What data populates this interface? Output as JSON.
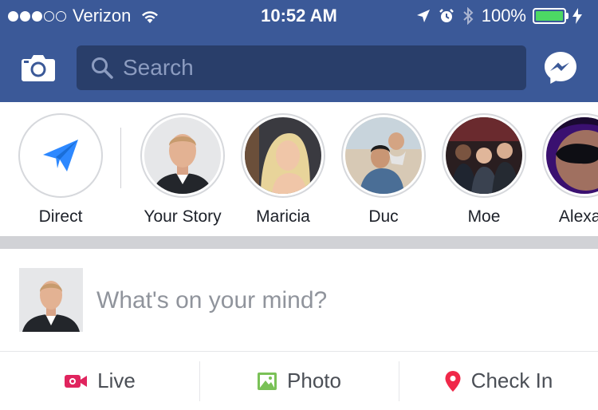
{
  "status_bar": {
    "carrier": "Verizon",
    "signal": {
      "full": 3,
      "empty": 2
    },
    "time": "10:52 AM",
    "battery_percent": "100%",
    "battery_level": 1.0,
    "battery_color": "#4cd964"
  },
  "header": {
    "bg_color": "#3b5998",
    "search_placeholder": "Search",
    "icons": [
      "camera-icon",
      "search-icon",
      "messenger-icon"
    ]
  },
  "stories": [
    {
      "name": "Direct",
      "icon": "paper-plane-icon"
    },
    {
      "name": "Your Story"
    },
    {
      "name": "Maricia"
    },
    {
      "name": "Duc"
    },
    {
      "name": "Moe"
    },
    {
      "name": "Alexan"
    }
  ],
  "composer": {
    "prompt": "What's on your mind?"
  },
  "actions": [
    {
      "label": "Live",
      "icon": "live-video-icon",
      "color": "#e0245e"
    },
    {
      "label": "Photo",
      "icon": "photo-icon",
      "color": "#7ac157"
    },
    {
      "label": "Check In",
      "icon": "location-pin-icon",
      "color": "#f02849"
    }
  ]
}
